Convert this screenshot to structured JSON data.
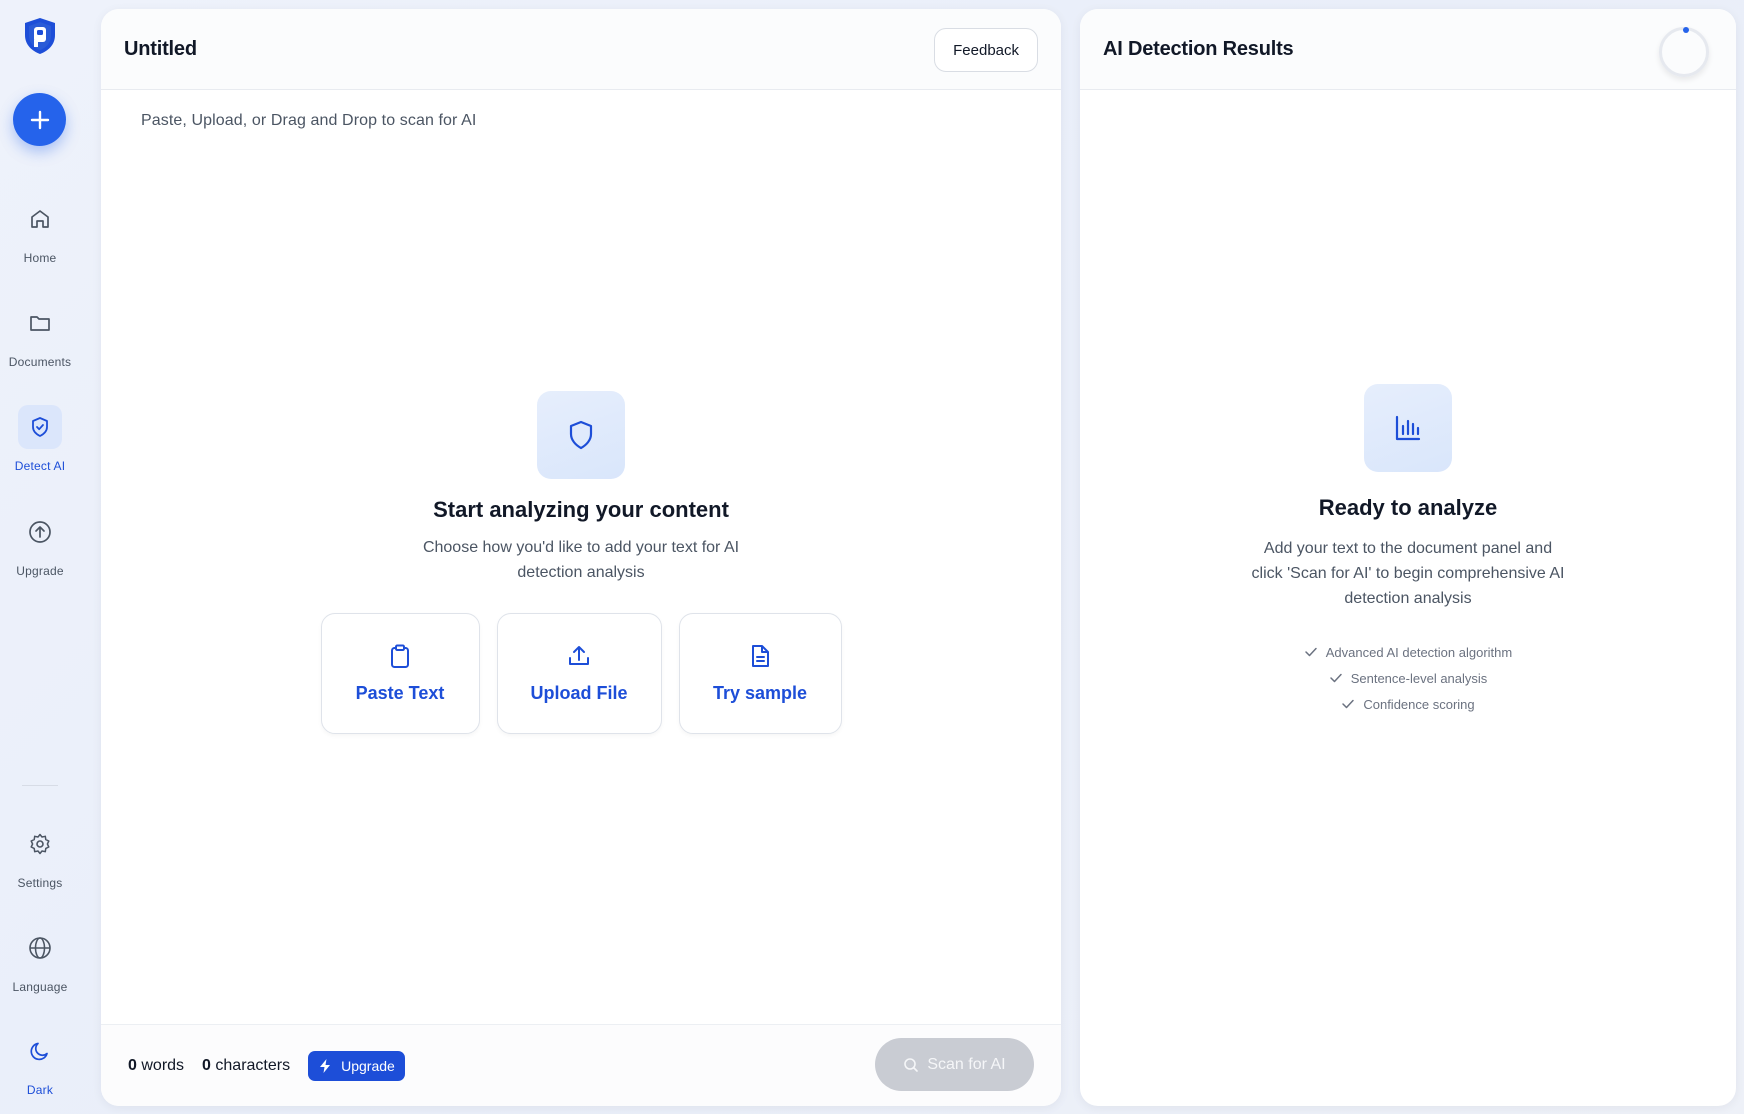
{
  "sidebar": {
    "items": [
      {
        "label": "Home",
        "icon": "home-icon"
      },
      {
        "label": "Documents",
        "icon": "folder-icon"
      },
      {
        "label": "Detect AI",
        "icon": "shield-check-icon",
        "active": true
      },
      {
        "label": "Upgrade",
        "icon": "arrow-up-circle-icon"
      },
      {
        "label": "Settings",
        "icon": "gear-icon"
      },
      {
        "label": "Language",
        "icon": "globe-icon"
      },
      {
        "label": "Dark",
        "icon": "moon-icon"
      }
    ]
  },
  "document": {
    "title": "Untitled",
    "feedback_label": "Feedback",
    "placeholder": "Paste, Upload, or Drag and Drop to scan for AI",
    "empty_title": "Start analyzing your content",
    "empty_desc": "Choose how you'd like to add your text for AI detection analysis",
    "actions": [
      {
        "label": "Paste Text",
        "icon": "clipboard-icon"
      },
      {
        "label": "Upload File",
        "icon": "upload-icon"
      },
      {
        "label": "Try sample",
        "icon": "document-icon"
      }
    ],
    "footer": {
      "words_count": "0",
      "words_label": "words",
      "chars_count": "0",
      "chars_label": "characters",
      "upgrade_label": "Upgrade",
      "scan_label": "Scan for AI"
    }
  },
  "results": {
    "title": "AI Detection Results",
    "empty_title": "Ready to analyze",
    "empty_desc": "Add your text to the document panel and click 'Scan for AI' to begin comprehensive AI detection analysis",
    "features": [
      "Advanced AI detection algorithm",
      "Sentence-level analysis",
      "Confidence scoring"
    ]
  },
  "colors": {
    "accent": "#2563eb",
    "accent_dark": "#1d4ed8",
    "active_bg": "#dbe6fb",
    "scan_disabled": "#c9ccd3"
  }
}
